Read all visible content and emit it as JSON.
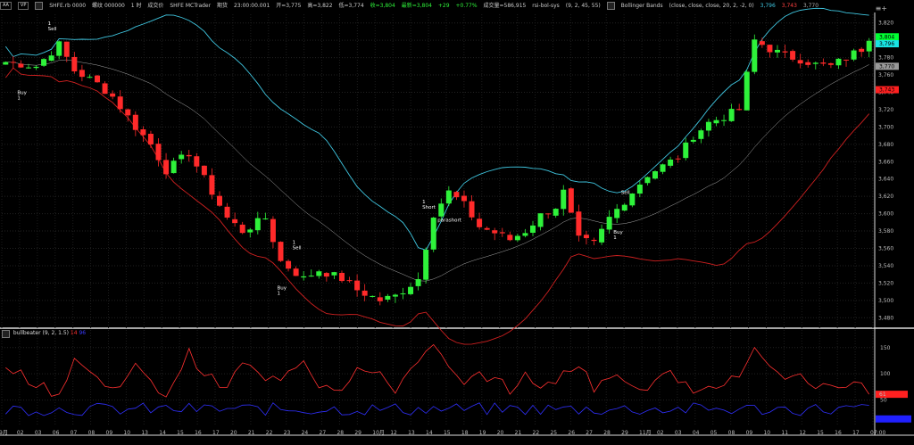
{
  "header": {
    "buttons": [
      "AA",
      "VP"
    ],
    "symbol": "SHFE.rb 0000",
    "name": "螺纹 000000",
    "period": "1 时",
    "trade_label": "成交价",
    "source": "SHFE MCTrader",
    "period_label": "期货",
    "time": "23:00:00.001",
    "open": "开=3,775",
    "high": "高=3,822",
    "low": "低=3,774",
    "close": "收=3,804",
    "last": "最新=3,804",
    "change": "+29",
    "change_pct": "+0.77%",
    "volume": "成交量=586,915",
    "strategy": "rsi-bol-sys",
    "strategy_params": "(9, 2, 45, 55)",
    "bb_name": "Bollinger Bands",
    "bb_params": "(close, close, close, 20, 2, -2, 0)",
    "bb_upper": "3,796",
    "bb_lower": "3,743",
    "bb_mid": "3,770",
    "toolbar_glyph": "≡+"
  },
  "price_axis": {
    "ticks": [
      "3,820",
      "3,800",
      "3,780",
      "3,760",
      "3,740",
      "3,720",
      "3,700",
      "3,680",
      "3,660",
      "3,640",
      "3,620",
      "3,600",
      "3,580",
      "3,560",
      "3,540",
      "3,520",
      "3,500",
      "3,480"
    ],
    "badges": [
      {
        "text": "3,804",
        "color": "#00ff33",
        "fg": "#000"
      },
      {
        "text": "3,796",
        "color": "#19e3e3",
        "fg": "#000"
      },
      {
        "text": "3,770",
        "color": "#999999",
        "fg": "#000"
      },
      {
        "text": "3,743",
        "color": "#ff2020",
        "fg": "#000"
      }
    ]
  },
  "indicator": {
    "name": "bullbeater",
    "params": "(9, 2, 1.5)",
    "val_red": "14",
    "val_blue": "96",
    "ticks": [
      "150",
      "100",
      "50"
    ],
    "badges": [
      {
        "text": "61",
        "color": "#ff2020"
      },
      {
        "text": "",
        "color": "#2020ff"
      }
    ]
  },
  "time_axis": {
    "labels": [
      "9月",
      "02",
      "03",
      "06",
      "07",
      "08",
      "09",
      "10",
      "13",
      "14",
      "15",
      "16",
      "17",
      "20",
      "21",
      "22",
      "23",
      "24",
      "27",
      "28",
      "29",
      "10月",
      "12",
      "13",
      "14",
      "15",
      "18",
      "19",
      "20",
      "21",
      "22",
      "25",
      "26",
      "27",
      "28",
      "29",
      "11月",
      "02",
      "03",
      "04",
      "05",
      "08",
      "09",
      "10",
      "11",
      "12",
      "15",
      "16",
      "17",
      "07:00"
    ]
  },
  "markers": [
    {
      "text": "1",
      "kind": "sell"
    },
    {
      "text": "Sell",
      "kind": "sell"
    },
    {
      "text": "Buy",
      "kind": "buy"
    },
    {
      "text": "1",
      "kind": "buy"
    },
    {
      "text": "1",
      "kind": "sell"
    },
    {
      "text": "Sell",
      "kind": "sell"
    },
    {
      "text": "Buy",
      "kind": "buy"
    },
    {
      "text": "1",
      "kind": "buy"
    },
    {
      "text": "1",
      "kind": "short"
    },
    {
      "text": "Short",
      "kind": "short"
    },
    {
      "text": "parashort",
      "kind": "exit"
    },
    {
      "text": "Sell",
      "kind": "sell"
    },
    {
      "text": "Buy",
      "kind": "buy"
    },
    {
      "text": "1",
      "kind": "buy"
    }
  ],
  "colors": {
    "up": "#2ef23a",
    "down": "#ff2a2a",
    "upper_band": "#3fc6e0",
    "lower_band": "#d02020",
    "mid_band": "#aaaaaa",
    "bb_red": "#ff3030",
    "bb_blue": "#3030ff"
  },
  "chart_data": {
    "type": "candlestick",
    "ylim": [
      3470,
      3830
    ],
    "close_path": [
      [
        0,
        3775
      ],
      [
        4,
        3770
      ],
      [
        7,
        3795
      ],
      [
        9,
        3765
      ],
      [
        12,
        3750
      ],
      [
        14,
        3735
      ],
      [
        17,
        3700
      ],
      [
        19,
        3680
      ],
      [
        21,
        3650
      ],
      [
        24,
        3670
      ],
      [
        26,
        3640
      ],
      [
        29,
        3595
      ],
      [
        31,
        3580
      ],
      [
        34,
        3595
      ],
      [
        36,
        3545
      ],
      [
        39,
        3525
      ],
      [
        41,
        3535
      ],
      [
        44,
        3525
      ],
      [
        46,
        3512
      ],
      [
        49,
        3500
      ],
      [
        51,
        3505
      ],
      [
        54,
        3525
      ],
      [
        56,
        3600
      ],
      [
        58,
        3625
      ],
      [
        60,
        3610
      ],
      [
        62,
        3585
      ],
      [
        64,
        3578
      ],
      [
        66,
        3570
      ],
      [
        68,
        3580
      ],
      [
        70,
        3598
      ],
      [
        72,
        3608
      ],
      [
        73,
        3625
      ],
      [
        75,
        3570
      ],
      [
        77,
        3565
      ],
      [
        79,
        3595
      ],
      [
        82,
        3625
      ],
      [
        84,
        3645
      ],
      [
        86,
        3655
      ],
      [
        88,
        3665
      ],
      [
        90,
        3690
      ],
      [
        92,
        3705
      ],
      [
        94,
        3712
      ],
      [
        96,
        3720
      ],
      [
        98,
        3800
      ],
      [
        100,
        3790
      ],
      [
        102,
        3782
      ],
      [
        104,
        3778
      ],
      [
        106,
        3772
      ],
      [
        108,
        3770
      ],
      [
        110,
        3780
      ],
      [
        112,
        3790
      ],
      [
        113,
        3804
      ]
    ],
    "bullbeater_red_peaks": [
      [
        0,
        120
      ],
      [
        4,
        80
      ],
      [
        7,
        60
      ],
      [
        9,
        130
      ],
      [
        12,
        90
      ],
      [
        14,
        70
      ],
      [
        17,
        115
      ],
      [
        19,
        80
      ],
      [
        21,
        60
      ],
      [
        24,
        140
      ],
      [
        26,
        100
      ],
      [
        29,
        70
      ],
      [
        31,
        125
      ],
      [
        34,
        85
      ],
      [
        36,
        95
      ],
      [
        39,
        130
      ],
      [
        41,
        80
      ],
      [
        44,
        75
      ],
      [
        46,
        110
      ],
      [
        49,
        95
      ],
      [
        51,
        70
      ],
      [
        54,
        130
      ],
      [
        56,
        150
      ],
      [
        58,
        110
      ],
      [
        60,
        75
      ],
      [
        62,
        100
      ],
      [
        64,
        90
      ],
      [
        66,
        70
      ],
      [
        68,
        95
      ],
      [
        70,
        80
      ],
      [
        72,
        75
      ],
      [
        73,
        105
      ],
      [
        75,
        120
      ],
      [
        77,
        75
      ],
      [
        79,
        95
      ],
      [
        82,
        80
      ],
      [
        84,
        75
      ],
      [
        86,
        110
      ],
      [
        88,
        85
      ],
      [
        90,
        70
      ],
      [
        92,
        85
      ],
      [
        94,
        75
      ],
      [
        96,
        100
      ],
      [
        98,
        145
      ],
      [
        100,
        110
      ],
      [
        102,
        80
      ],
      [
        104,
        95
      ],
      [
        106,
        75
      ],
      [
        108,
        85
      ],
      [
        110,
        70
      ],
      [
        112,
        90
      ],
      [
        113,
        61
      ]
    ]
  }
}
